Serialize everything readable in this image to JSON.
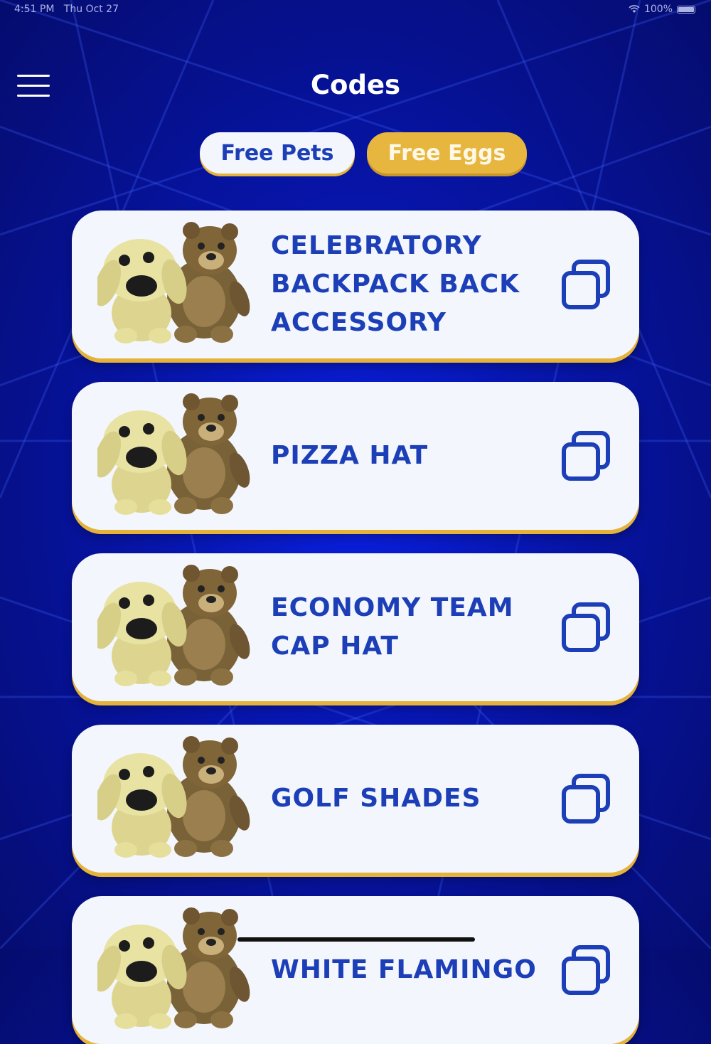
{
  "status_bar": {
    "time": "4:51 PM",
    "date": "Thu Oct 27",
    "battery": "100%"
  },
  "header": {
    "title": "Codes",
    "menu_icon": "hamburger-menu-icon"
  },
  "tabs": [
    {
      "label": "Free Pets",
      "selected": false
    },
    {
      "label": "Free Eggs",
      "selected": true
    }
  ],
  "codes": [
    {
      "text": "CELEBRATORY\nBACKPACK BACK\nACCESSORY",
      "image": "dog-and-bear-pets"
    },
    {
      "text": "PIZZA HAT",
      "image": "dog-and-bear-pets"
    },
    {
      "text": "ECONOMY TEAM\nCAP HAT",
      "image": "dog-and-bear-pets"
    },
    {
      "text": "GOLF SHADES",
      "image": "dog-and-bear-pets"
    },
    {
      "text": "WHITE FLAMINGO",
      "image": "dog-and-bear-pets"
    }
  ],
  "colors": {
    "background": "#0716b0",
    "card": "#f3f6fc",
    "accent_gold": "#e6b63f",
    "text_blue": "#1c3fb8"
  }
}
